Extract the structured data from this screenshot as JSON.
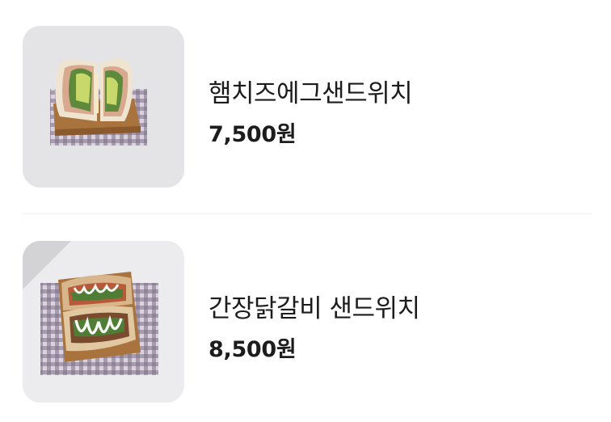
{
  "menu": {
    "items": [
      {
        "name": "햄치즈에그샌드위치",
        "price": "7,500원",
        "image": "ham-cheese-egg-sandwich-photo"
      },
      {
        "name": "간장닭갈비 샌드위치",
        "price": "8,500원",
        "image": "soy-chicken-galbi-sandwich-photo"
      }
    ]
  }
}
